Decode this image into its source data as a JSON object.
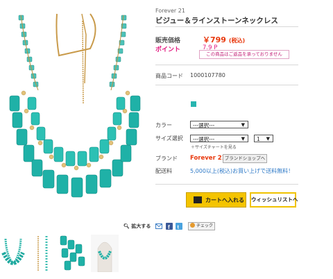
{
  "product": {
    "brand": "Forever 21",
    "title": "ビジュー＆ラインストーンネックレス",
    "price_label": "販売価格",
    "price": "￥799",
    "price_tax": "(税込)",
    "point_label": "ポイント",
    "point": "7.9 P",
    "point_notice": "この商品はご返品を承っておりません",
    "code_label": "商品コード",
    "code": "1000107780"
  },
  "options": {
    "color_label": "カラー",
    "color_select": "---選択---",
    "size_label": "サイズ選択",
    "size_select": "---選択---",
    "qty": "1",
    "size_chart_link": "＋サイズチャートを見る",
    "swatch_color": "#28b5b0"
  },
  "brand_row": {
    "label": "ブランド",
    "name": "Forever 21",
    "shop_button": "ブランドショップへ"
  },
  "shipping": {
    "label": "配送料",
    "text": "5,000以上(税込)お買い上げで送料無料！"
  },
  "actions": {
    "cart_button": "カートへ入れる",
    "wishlist_button": "ウィッシュリストへ",
    "zoom_label": "拡大する",
    "check_button": "チェック"
  },
  "icons": [
    "mail-icon",
    "facebook-icon",
    "twitter-icon",
    "check-icon"
  ],
  "colors": {
    "accent": "#e8380d",
    "point": "#e2187f",
    "button": "#f4c400",
    "link": "#2d79c7"
  }
}
